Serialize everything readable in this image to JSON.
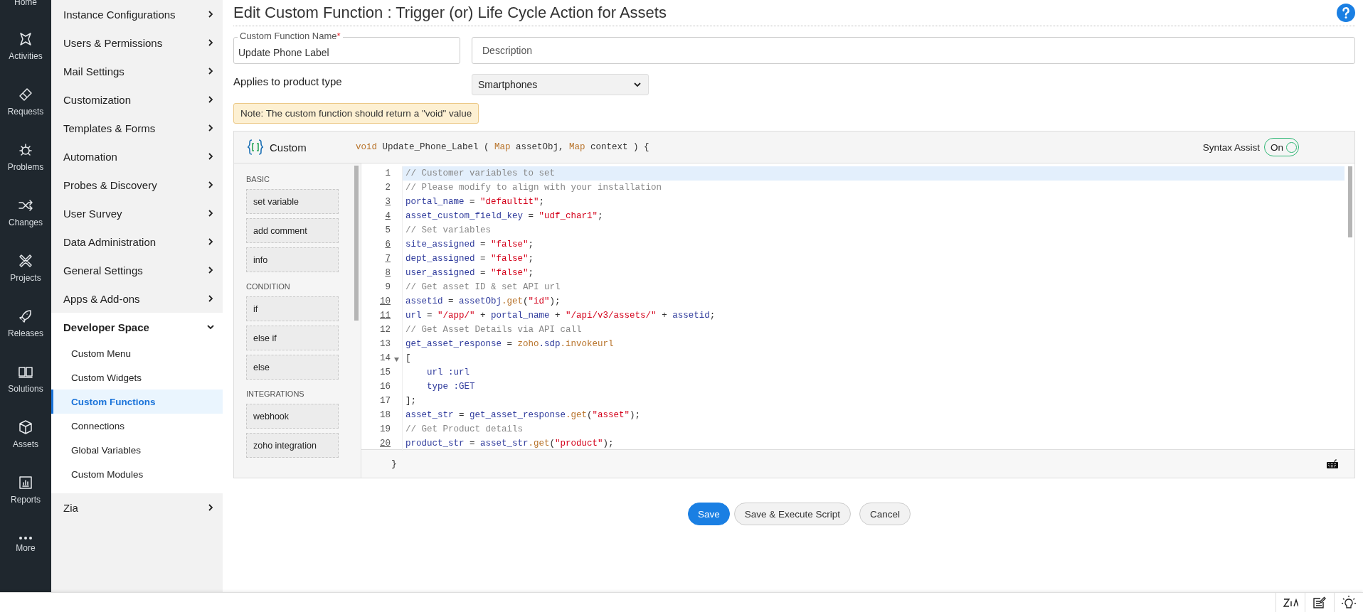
{
  "rail": {
    "items": [
      {
        "label": "Home",
        "kind": "home"
      },
      {
        "label": "Activities",
        "kind": "activities"
      },
      {
        "label": "Requests",
        "kind": "requests"
      },
      {
        "label": "Problems",
        "kind": "problems"
      },
      {
        "label": "Changes",
        "kind": "changes"
      },
      {
        "label": "Projects",
        "kind": "projects"
      },
      {
        "label": "Releases",
        "kind": "releases"
      },
      {
        "label": "Solutions",
        "kind": "solutions"
      },
      {
        "label": "Assets",
        "kind": "assets"
      },
      {
        "label": "Reports",
        "kind": "reports"
      },
      {
        "label": "More",
        "kind": "more"
      }
    ]
  },
  "sidebar": {
    "items": [
      {
        "label": "Instance Configurations",
        "expanded": false
      },
      {
        "label": "Users & Permissions",
        "expanded": false
      },
      {
        "label": "Mail Settings",
        "expanded": false
      },
      {
        "label": "Customization",
        "expanded": false
      },
      {
        "label": "Templates & Forms",
        "expanded": false
      },
      {
        "label": "Automation",
        "expanded": false
      },
      {
        "label": "Probes & Discovery",
        "expanded": false
      },
      {
        "label": "User Survey",
        "expanded": false
      },
      {
        "label": "Data Administration",
        "expanded": false
      },
      {
        "label": "General Settings",
        "expanded": false
      },
      {
        "label": "Apps & Add-ons",
        "expanded": false
      },
      {
        "label": "Developer Space",
        "expanded": true,
        "children": [
          {
            "label": "Custom Menu",
            "selected": false
          },
          {
            "label": "Custom Widgets",
            "selected": false
          },
          {
            "label": "Custom Functions",
            "selected": true
          },
          {
            "label": "Connections",
            "selected": false
          },
          {
            "label": "Global Variables",
            "selected": false
          },
          {
            "label": "Custom Modules",
            "selected": false
          }
        ]
      },
      {
        "label": "Zia",
        "expanded": false
      }
    ]
  },
  "page": {
    "title": "Edit Custom Function : Trigger (or) Life Cycle Action for Assets",
    "form": {
      "name_field": {
        "label": "Custom Function Name",
        "required_mark": "*",
        "value": "Update Phone Label"
      },
      "description_field": {
        "placeholder": "Description"
      },
      "product_type": {
        "label": "Applies to product type",
        "value": "Smartphones"
      },
      "note": "Note: The custom function should return a \"void\" value"
    },
    "editor": {
      "mode_label": "Custom",
      "signature": [
        {
          "kind": "keyword",
          "text": "void"
        },
        {
          "kind": "plain",
          "text": " Update_Phone_Label"
        },
        {
          "kind": "plain",
          "text": " ( "
        },
        {
          "kind": "keyword",
          "text": "Map"
        },
        {
          "kind": "plain",
          "text": " assetObj, "
        },
        {
          "kind": "keyword",
          "text": "Map"
        },
        {
          "kind": "plain",
          "text": " context ) {"
        }
      ],
      "syntax_assist": {
        "label": "Syntax Assist",
        "state_text": "On",
        "on": true
      },
      "palette": [
        {
          "heading": "BASIC",
          "blocks": [
            "set variable",
            "add comment",
            "info"
          ]
        },
        {
          "heading": "CONDITION",
          "blocks": [
            "if",
            "else if",
            "else"
          ]
        },
        {
          "heading": "INTEGRATIONS",
          "blocks": [
            "webhook",
            "zoho integration"
          ]
        }
      ],
      "lines": [
        {
          "number": "1",
          "underlined": false,
          "foldable": false,
          "highlighted": true,
          "tokens": [
            {
              "kind": "comment",
              "text": "// Customer variables to set"
            }
          ]
        },
        {
          "number": "2",
          "underlined": false,
          "foldable": false,
          "highlighted": false,
          "tokens": [
            {
              "kind": "comment",
              "text": "// Please modify to align with your installation"
            }
          ]
        },
        {
          "number": "3",
          "underlined": true,
          "foldable": false,
          "highlighted": false,
          "tokens": [
            {
              "kind": "var",
              "text": "portal_name"
            },
            {
              "kind": "plain",
              "text": " = "
            },
            {
              "kind": "string",
              "text": "\"defaultit\""
            },
            {
              "kind": "plain",
              "text": ";"
            }
          ]
        },
        {
          "number": "4",
          "underlined": true,
          "foldable": false,
          "highlighted": false,
          "tokens": [
            {
              "kind": "var",
              "text": "asset_custom_field_key"
            },
            {
              "kind": "plain",
              "text": " = "
            },
            {
              "kind": "string",
              "text": "\"udf_char1\""
            },
            {
              "kind": "plain",
              "text": ";"
            }
          ]
        },
        {
          "number": "5",
          "underlined": false,
          "foldable": false,
          "highlighted": false,
          "tokens": [
            {
              "kind": "comment",
              "text": "// Set variables"
            }
          ]
        },
        {
          "number": "6",
          "underlined": true,
          "foldable": false,
          "highlighted": false,
          "tokens": [
            {
              "kind": "var",
              "text": "site_assigned"
            },
            {
              "kind": "plain",
              "text": " = "
            },
            {
              "kind": "string",
              "text": "\"false\""
            },
            {
              "kind": "plain",
              "text": ";"
            }
          ]
        },
        {
          "number": "7",
          "underlined": true,
          "foldable": false,
          "highlighted": false,
          "tokens": [
            {
              "kind": "var",
              "text": "dept_assigned"
            },
            {
              "kind": "plain",
              "text": " = "
            },
            {
              "kind": "string",
              "text": "\"false\""
            },
            {
              "kind": "plain",
              "text": ";"
            }
          ]
        },
        {
          "number": "8",
          "underlined": true,
          "foldable": false,
          "highlighted": false,
          "tokens": [
            {
              "kind": "var",
              "text": "user_assigned"
            },
            {
              "kind": "plain",
              "text": " = "
            },
            {
              "kind": "string",
              "text": "\"false\""
            },
            {
              "kind": "plain",
              "text": ";"
            }
          ]
        },
        {
          "number": "9",
          "underlined": false,
          "foldable": false,
          "highlighted": false,
          "tokens": [
            {
              "kind": "comment",
              "text": "// Get asset ID & set API url"
            }
          ]
        },
        {
          "number": "10",
          "underlined": true,
          "foldable": false,
          "highlighted": false,
          "tokens": [
            {
              "kind": "var",
              "text": "assetid"
            },
            {
              "kind": "plain",
              "text": " = "
            },
            {
              "kind": "var",
              "text": "assetObj"
            },
            {
              "kind": "method",
              "text": ".get"
            },
            {
              "kind": "plain",
              "text": "("
            },
            {
              "kind": "string",
              "text": "\"id\""
            },
            {
              "kind": "plain",
              "text": ");"
            }
          ]
        },
        {
          "number": "11",
          "underlined": true,
          "foldable": false,
          "highlighted": false,
          "tokens": [
            {
              "kind": "var",
              "text": "url"
            },
            {
              "kind": "plain",
              "text": " = "
            },
            {
              "kind": "string",
              "text": "\"/app/\""
            },
            {
              "kind": "plain",
              "text": " + "
            },
            {
              "kind": "var",
              "text": "portal_name"
            },
            {
              "kind": "plain",
              "text": " + "
            },
            {
              "kind": "string",
              "text": "\"/api/v3/assets/\""
            },
            {
              "kind": "plain",
              "text": " + "
            },
            {
              "kind": "var",
              "text": "assetid"
            },
            {
              "kind": "plain",
              "text": ";"
            }
          ]
        },
        {
          "number": "12",
          "underlined": false,
          "foldable": false,
          "highlighted": false,
          "tokens": [
            {
              "kind": "comment",
              "text": "// Get Asset Details via API call"
            }
          ]
        },
        {
          "number": "13",
          "underlined": false,
          "foldable": false,
          "highlighted": false,
          "tokens": [
            {
              "kind": "var",
              "text": "get_asset_response"
            },
            {
              "kind": "plain",
              "text": " = "
            },
            {
              "kind": "method",
              "text": "zoho"
            },
            {
              "kind": "var",
              "text": ".sdp"
            },
            {
              "kind": "method",
              "text": ".invokeurl"
            }
          ]
        },
        {
          "number": "14",
          "underlined": false,
          "foldable": true,
          "highlighted": false,
          "tokens": [
            {
              "kind": "plain",
              "text": "["
            }
          ]
        },
        {
          "number": "15",
          "underlined": false,
          "foldable": false,
          "highlighted": false,
          "tokens": [
            {
              "kind": "var",
              "text": "    url :url"
            }
          ]
        },
        {
          "number": "16",
          "underlined": false,
          "foldable": false,
          "highlighted": false,
          "tokens": [
            {
              "kind": "var",
              "text": "    type :GET"
            }
          ]
        },
        {
          "number": "17",
          "underlined": false,
          "foldable": false,
          "highlighted": false,
          "tokens": [
            {
              "kind": "plain",
              "text": "];"
            }
          ]
        },
        {
          "number": "18",
          "underlined": false,
          "foldable": false,
          "highlighted": false,
          "tokens": [
            {
              "kind": "var",
              "text": "asset_str"
            },
            {
              "kind": "plain",
              "text": " = "
            },
            {
              "kind": "var",
              "text": "get_asset_response"
            },
            {
              "kind": "method",
              "text": ".get"
            },
            {
              "kind": "plain",
              "text": "("
            },
            {
              "kind": "string",
              "text": "\"asset\""
            },
            {
              "kind": "plain",
              "text": ");"
            }
          ]
        },
        {
          "number": "19",
          "underlined": false,
          "foldable": false,
          "highlighted": false,
          "tokens": [
            {
              "kind": "comment",
              "text": "// Get Product details"
            }
          ]
        },
        {
          "number": "20",
          "underlined": true,
          "foldable": false,
          "highlighted": false,
          "tokens": [
            {
              "kind": "var",
              "text": "product_str"
            },
            {
              "kind": "plain",
              "text": " = "
            },
            {
              "kind": "var",
              "text": "asset_str"
            },
            {
              "kind": "method",
              "text": ".get"
            },
            {
              "kind": "plain",
              "text": "("
            },
            {
              "kind": "string",
              "text": "\"product\""
            },
            {
              "kind": "plain",
              "text": ");"
            }
          ]
        }
      ],
      "closing": "}"
    },
    "buttons": [
      {
        "label": "Save",
        "kind": "primary"
      },
      {
        "label": "Save & Execute Script",
        "kind": "secondary"
      },
      {
        "label": "Cancel",
        "kind": "secondary"
      }
    ]
  }
}
